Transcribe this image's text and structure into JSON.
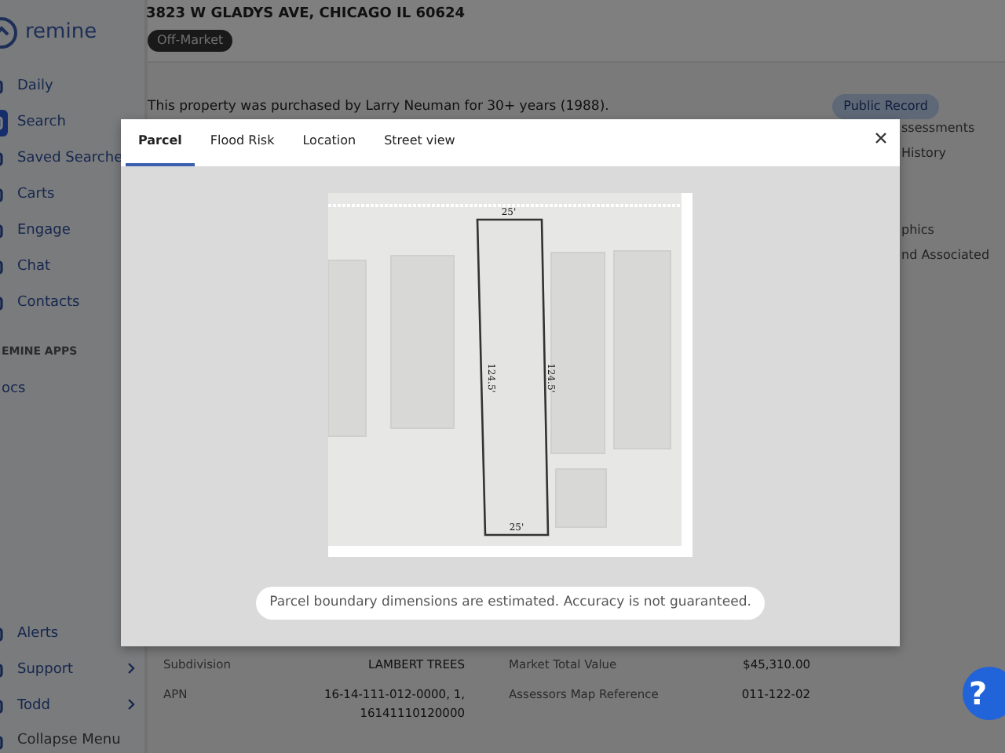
{
  "sidebar": {
    "logo": "remine",
    "items": [
      {
        "label": "Daily",
        "selected": false
      },
      {
        "label": "Search",
        "selected": true
      },
      {
        "label": "Saved Searche",
        "selected": false
      },
      {
        "label": "Carts",
        "selected": false
      },
      {
        "label": "Engage",
        "selected": false
      },
      {
        "label": "Chat",
        "selected": false
      },
      {
        "label": "Contacts",
        "selected": false
      }
    ],
    "section_title": "EMINE APPS",
    "apps": [
      {
        "label": "ocs"
      }
    ],
    "bottom_items": [
      {
        "label": "Alerts"
      },
      {
        "label": "Support",
        "has_submenu": true
      },
      {
        "label": "Todd",
        "has_submenu": true
      },
      {
        "label": "Collapse Menu",
        "has_submenu": false
      }
    ]
  },
  "property": {
    "address": "3823 W GLADYS AVE, CHICAGO IL 60624",
    "status": "Off-Market",
    "summary": "This property was purchased by Larry Neuman for 30+ years (1988).",
    "source_badge": "Public Record",
    "side_links": [
      "ssessments",
      "History",
      "phics",
      "nd Associated"
    ],
    "details_left": [
      {
        "label": "Subdivision",
        "value": "LAMBERT TREES"
      },
      {
        "label": "APN",
        "value": "16-14-111-012-0000, 1, 16141110120000"
      }
    ],
    "details_right": [
      {
        "label": "Market Total Value",
        "value": "$45,310.00"
      },
      {
        "label": "Assessors Map Reference",
        "value": "011-122-02"
      }
    ]
  },
  "modal": {
    "tabs": [
      {
        "label": "Parcel",
        "selected": true
      },
      {
        "label": "Flood Risk",
        "selected": false
      },
      {
        "label": "Location",
        "selected": false
      },
      {
        "label": "Street view",
        "selected": false
      }
    ],
    "map": {
      "dimensions": {
        "top": "25'",
        "bottom": "25'",
        "left": "124.5'",
        "right": "124.5'"
      }
    },
    "note": "Parcel boundary dimensions are estimated. Accuracy is not guaranteed."
  },
  "help_button": "?"
}
